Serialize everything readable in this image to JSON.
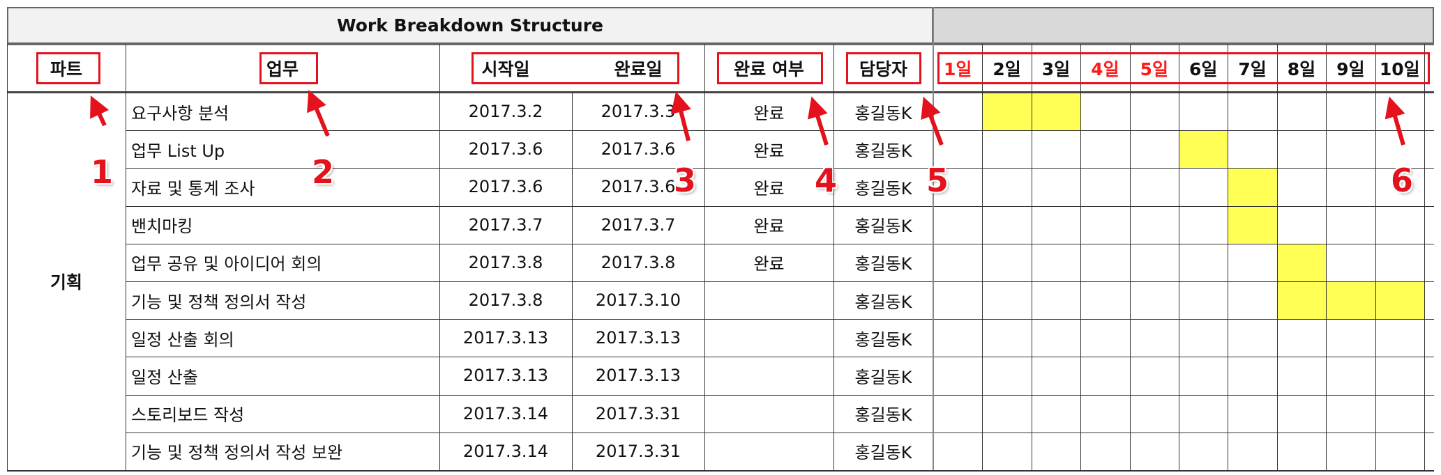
{
  "title": "Work Breakdown Structure",
  "headers": {
    "part": "파트",
    "task": "업무",
    "start": "시작일",
    "end": "완료일",
    "done": "완료 여부",
    "owner": "담당자"
  },
  "days": [
    {
      "label": "1일",
      "red": true
    },
    {
      "label": "2일",
      "red": false
    },
    {
      "label": "3일",
      "red": false
    },
    {
      "label": "4일",
      "red": true
    },
    {
      "label": "5일",
      "red": true
    },
    {
      "label": "6일",
      "red": false
    },
    {
      "label": "7일",
      "red": false
    },
    {
      "label": "8일",
      "red": false
    },
    {
      "label": "9일",
      "red": false
    },
    {
      "label": "10일",
      "red": false
    }
  ],
  "part_name": "기획",
  "rows": [
    {
      "task": "요구사항 분석",
      "start": "2017.3.2",
      "end": "2017.3.3",
      "done": "완료",
      "owner": "홍길동K",
      "fill_days": [
        2,
        3
      ]
    },
    {
      "task": "업무 List Up",
      "start": "2017.3.6",
      "end": "2017.3.6",
      "done": "완료",
      "owner": "홍길동K",
      "fill_days": [
        6
      ]
    },
    {
      "task": "자료 및 통계 조사",
      "start": "2017.3.6",
      "end": "2017.3.6",
      "done": "완료",
      "owner": "홍길동K",
      "fill_days": [
        7
      ]
    },
    {
      "task": "밴치마킹",
      "start": "2017.3.7",
      "end": "2017.3.7",
      "done": "완료",
      "owner": "홍길동K",
      "fill_days": [
        7
      ]
    },
    {
      "task": "업무 공유 및 아이디어 회의",
      "start": "2017.3.8",
      "end": "2017.3.8",
      "done": "완료",
      "owner": "홍길동K",
      "fill_days": [
        8
      ]
    },
    {
      "task": "기능 및 정책 정의서 작성",
      "start": "2017.3.8",
      "end": "2017.3.10",
      "done": "",
      "owner": "홍길동K",
      "fill_days": [
        8,
        9,
        10
      ]
    },
    {
      "task": "일정 산출 회의",
      "start": "2017.3.13",
      "end": "2017.3.13",
      "done": "",
      "owner": "홍길동K",
      "fill_days": []
    },
    {
      "task": "일정 산출",
      "start": "2017.3.13",
      "end": "2017.3.13",
      "done": "",
      "owner": "홍길동K",
      "fill_days": []
    },
    {
      "task": "스토리보드 작성",
      "start": "2017.3.14",
      "end": "2017.3.31",
      "done": "",
      "owner": "홍길동K",
      "fill_days": []
    },
    {
      "task": "기능 및 정책 정의서 작성 보완",
      "start": "2017.3.14",
      "end": "2017.3.31",
      "done": "",
      "owner": "홍길동K",
      "fill_days": []
    }
  ],
  "annotations": [
    "1",
    "2",
    "3",
    "4",
    "5",
    "6"
  ],
  "colors": {
    "highlight": "#ffff55",
    "annotation": "#e3121d",
    "weekend": "#ff1a1a"
  }
}
